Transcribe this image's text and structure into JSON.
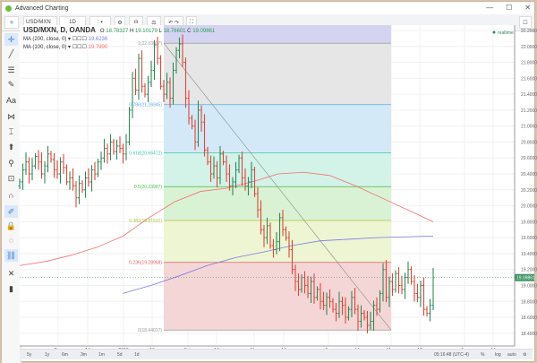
{
  "window": {
    "title": "Advanced Charting",
    "controls": [
      "—",
      "☐",
      "✕"
    ]
  },
  "toolbar": {
    "symbol": "USD/MXN",
    "interval": "1D",
    "icons": [
      "bar-style-icon",
      "settings-icon",
      "indicators-icon",
      "compare-icon",
      "undo-icon",
      "redo-icon",
      "fullscreen-icon"
    ]
  },
  "legend": {
    "symbol_line": "USD/MXN, D, OANDA",
    "ohlc": {
      "o_label": "O",
      "o": "18.78327",
      "h_label": "H",
      "h": "19.10179",
      "l_label": "L",
      "l": "18.76601",
      "c_label": "C",
      "c": "19.09861"
    },
    "ma200": {
      "label": "MA (200, close, 0)",
      "value": "19.6236",
      "color": "#7b7be0"
    },
    "ma100": {
      "label": "MA (100, close, 0)",
      "value": "19.7990",
      "color": "#f07070"
    }
  },
  "realtime_label": "realtime",
  "last_price": "19.09861",
  "left_tools": [
    "crosshair-icon",
    "trendline-icon",
    "fib-icon",
    "brush-icon",
    "text-icon",
    "pattern-icon",
    "measure-icon",
    "arrow-up-icon",
    "zoom-icon",
    "ruler-icon",
    "magnet-icon",
    "pencil-lock-icon",
    "lock-icon",
    "eye-icon",
    "link-icon",
    "remove-drawings-icon",
    "trash-icon"
  ],
  "bottom": {
    "ranges": [
      "5y",
      "1y",
      "6m",
      "3m",
      "1m",
      "5d",
      "1d"
    ],
    "time": "05:16:48 (UTC-4)",
    "percent": "%",
    "log": "log",
    "auto": "auto"
  },
  "chart_data": {
    "type": "ohlc",
    "symbol": "USD/MXN",
    "ylim": [
      18.3,
      22.3
    ],
    "y_ticks": [
      "22.20000",
      "22.00000",
      "21.80000",
      "21.60000",
      "21.40000",
      "21.20000",
      "21.00000",
      "20.80000",
      "20.60000",
      "20.40000",
      "20.20000",
      "20.00000",
      "19.80000",
      "19.60000",
      "19.40000",
      "19.20000",
      "19.00000",
      "18.80000",
      "18.60000",
      "18.40000"
    ],
    "x_ticks": [
      "Dec",
      "14",
      "2017",
      "16",
      "Feb",
      "14",
      "Mar",
      "14",
      "Apr",
      "14",
      "May",
      "12",
      "Jun",
      "14"
    ],
    "closes": [
      20.3,
      20.45,
      20.55,
      20.4,
      20.5,
      20.62,
      20.55,
      20.4,
      20.5,
      20.65,
      20.58,
      20.45,
      20.4,
      20.55,
      20.48,
      20.3,
      20.35,
      20.25,
      20.1,
      20.28,
      20.2,
      20.35,
      20.3,
      20.45,
      20.4,
      20.55,
      20.6,
      20.72,
      20.65,
      20.8,
      20.68,
      20.75,
      20.72,
      20.65,
      20.8,
      21.2,
      21.6,
      21.45,
      21.85,
      21.5,
      21.4,
      21.55,
      21.7,
      22.02,
      21.85,
      21.5,
      21.4,
      21.55,
      21.35,
      21.7,
      21.95,
      22.03,
      21.8,
      21.35,
      21.1,
      21.0,
      20.8,
      21.2,
      21.05,
      20.7,
      20.55,
      20.4,
      20.5,
      20.35,
      20.65,
      20.55,
      20.4,
      20.25,
      20.3,
      20.45,
      20.6,
      20.35,
      20.25,
      20.3,
      20.45,
      20.15,
      19.95,
      19.7,
      19.6,
      19.75,
      19.5,
      19.45,
      19.55,
      19.85,
      19.7,
      19.6,
      19.45,
      19.2,
      19.05,
      18.95,
      19.1,
      19.0,
      18.9,
      19.05,
      18.85,
      18.95,
      18.8,
      18.75,
      18.85,
      18.8,
      18.7,
      18.65,
      18.8,
      18.75,
      18.6,
      18.7,
      18.85,
      18.7,
      18.55,
      18.65,
      18.6,
      18.5,
      18.55,
      18.75,
      18.7,
      18.9,
      19.2,
      18.85,
      19.05,
      18.95,
      19.15,
      19.0,
      18.95,
      19.1,
      19.2,
      19.05,
      18.9,
      18.85,
      19.0,
      18.7,
      18.65,
      18.75,
      19.09861
    ],
    "ma100": [
      19.25,
      19.3,
      19.38,
      19.48,
      19.62,
      19.85,
      20.05,
      20.18,
      20.22,
      20.3,
      20.4,
      20.42,
      20.38,
      20.25,
      20.1,
      19.95,
      19.8
    ],
    "ma200": [
      18.9,
      19.0,
      19.12,
      19.25,
      19.35,
      19.42,
      19.5,
      19.56,
      19.58,
      19.6,
      19.61,
      19.62
    ],
    "fib": {
      "levels": [
        {
          "ratio": "1",
          "price": "22.03977",
          "color": "#999999",
          "fill": "#e6e6e6"
        },
        {
          "ratio": "0.786",
          "price": "21.26945",
          "color": "#5aaee8",
          "fill": "#d4e9f7"
        },
        {
          "ratio": "0.618",
          "price": "20.66472",
          "color": "#3cc9a8",
          "fill": "#d3f2e8"
        },
        {
          "ratio": "0.5",
          "price": "20.23997",
          "color": "#4cba4c",
          "fill": "#d9f2d3"
        },
        {
          "ratio": "0.382",
          "price": "19.81522",
          "color": "#a8c83c",
          "fill": "#edf5d3"
        },
        {
          "ratio": "0.236",
          "price": "19.28968",
          "color": "#e06060",
          "fill": "#f5d6d6"
        },
        {
          "ratio": "0",
          "price": "18.44017",
          "color": "#999999",
          "fill": ""
        }
      ]
    }
  }
}
